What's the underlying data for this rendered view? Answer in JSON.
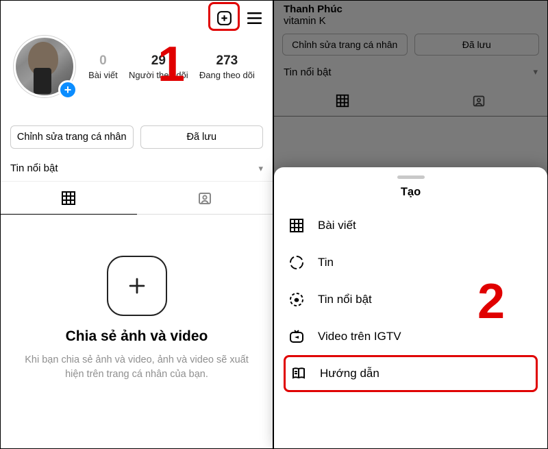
{
  "left": {
    "stats": {
      "posts": {
        "count": "0",
        "label": "Bài viết"
      },
      "followers": {
        "count": "29",
        "label": "Người theo dõi"
      },
      "following": {
        "count": "273",
        "label": "Đang theo dõi"
      }
    },
    "buttons": {
      "edit": "Chỉnh sửa trang cá nhân",
      "saved": "Đã lưu"
    },
    "highlights_label": "Tin nổi bật",
    "empty": {
      "title": "Chia sẻ ảnh và video",
      "subtitle": "Khi bạn chia sẻ ảnh và video, ảnh và video sẽ xuất hiện trên trang cá nhân của bạn."
    }
  },
  "right": {
    "dimmed": {
      "name": "Thanh Phúc",
      "sub": "vitamin K",
      "buttons": {
        "edit": "Chỉnh sửa trang cá nhân",
        "saved": "Đã lưu"
      },
      "highlights_label": "Tin nổi bật"
    },
    "sheet": {
      "title": "Tạo",
      "items": [
        {
          "key": "post",
          "label": "Bài viết"
        },
        {
          "key": "story",
          "label": "Tin"
        },
        {
          "key": "highlight",
          "label": "Tin nổi bật"
        },
        {
          "key": "igtv",
          "label": "Video trên IGTV"
        },
        {
          "key": "guide",
          "label": "Hướng dẫn"
        }
      ]
    }
  },
  "annotations": {
    "step1": "1",
    "step2": "2"
  }
}
